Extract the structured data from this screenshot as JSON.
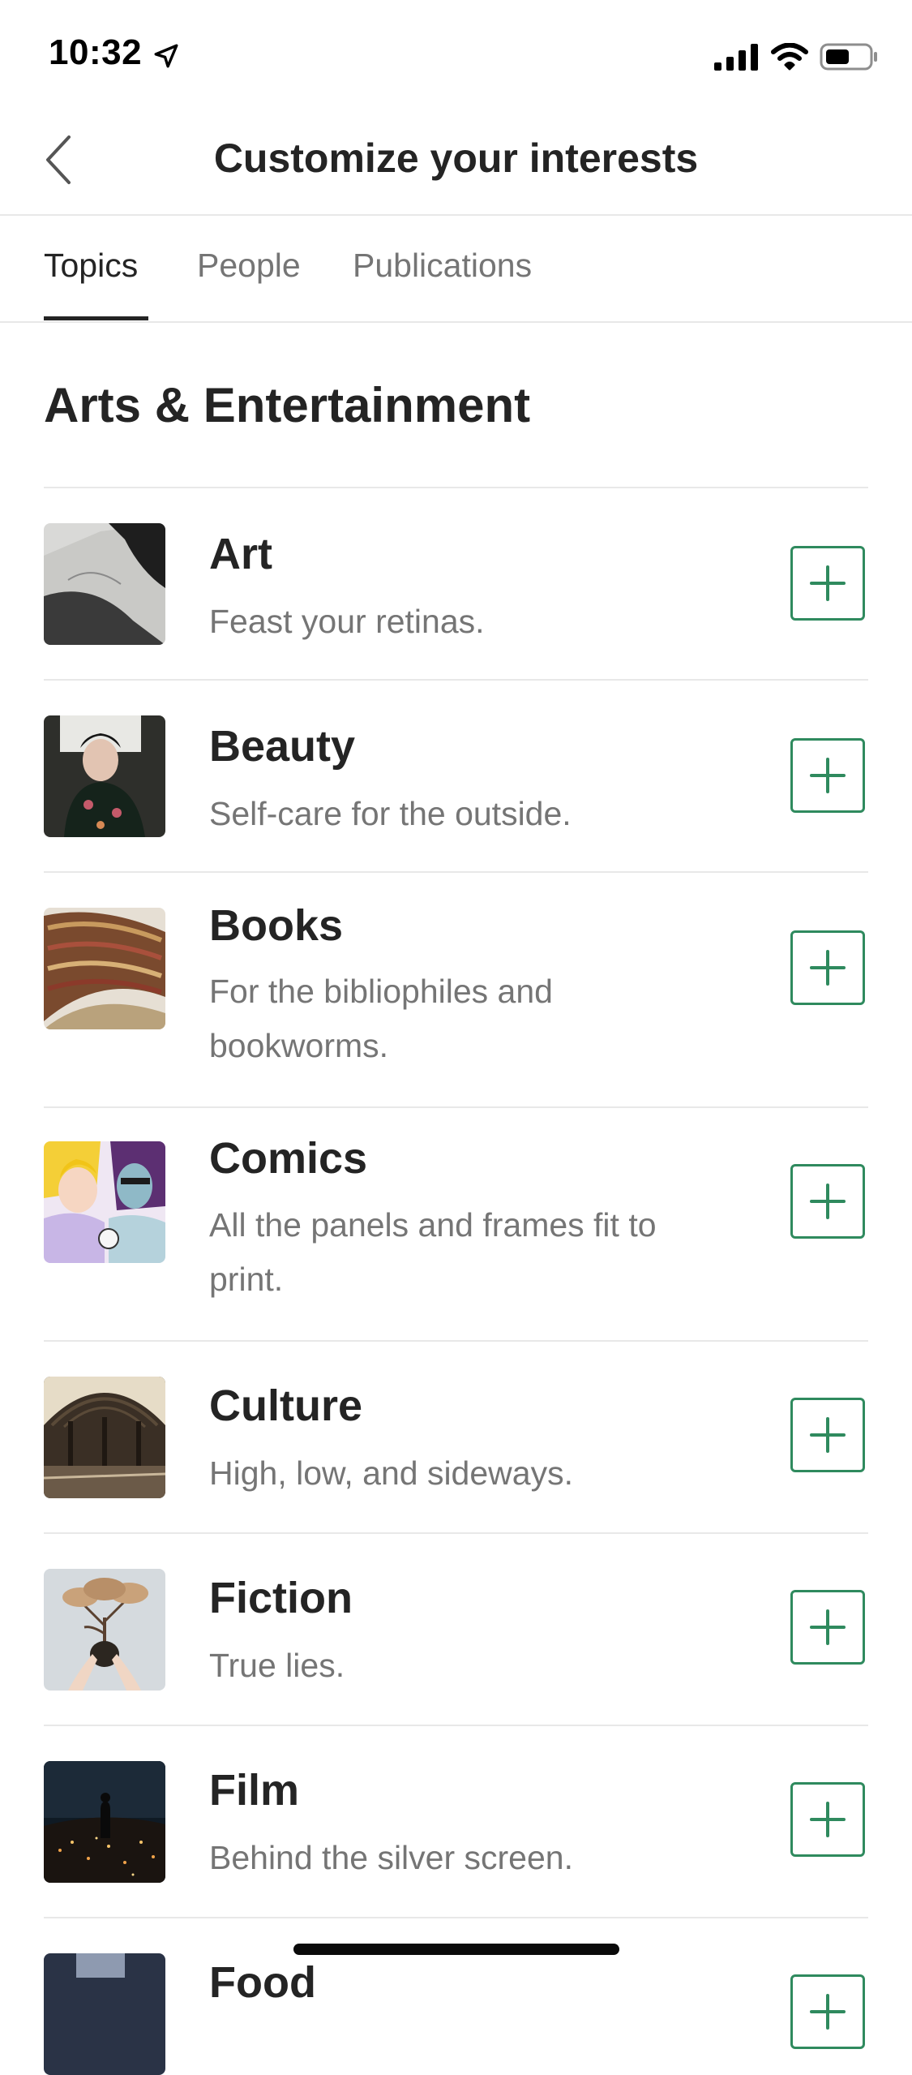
{
  "status_bar": {
    "time": "10:32"
  },
  "nav": {
    "title": "Customize your interests"
  },
  "tabs": [
    {
      "label": "Topics",
      "active": true
    },
    {
      "label": "People",
      "active": false
    },
    {
      "label": "Publications",
      "active": false
    }
  ],
  "section": {
    "title": "Arts & Entertainment"
  },
  "topics": [
    {
      "name": "Art",
      "description": "Feast your retinas."
    },
    {
      "name": "Beauty",
      "description": "Self-care for the outside."
    },
    {
      "name": "Books",
      "description": "For the bibliophiles and bookworms."
    },
    {
      "name": "Comics",
      "description": "All the panels and frames fit to print."
    },
    {
      "name": "Culture",
      "description": "High, low, and sideways."
    },
    {
      "name": "Fiction",
      "description": "True lies."
    },
    {
      "name": "Film",
      "description": "Behind the silver screen."
    },
    {
      "name": "Food",
      "description": ""
    }
  ],
  "colors": {
    "accent": "#2f8a5e",
    "text_primary": "#242424",
    "text_secondary": "#757575",
    "divider": "#e8e8e8"
  },
  "icons": {
    "back": "chevron-left-icon",
    "follow": "plus-icon",
    "location": "location-arrow-icon",
    "signal": "cellular-signal-icon",
    "wifi": "wifi-icon",
    "battery": "battery-icon"
  }
}
